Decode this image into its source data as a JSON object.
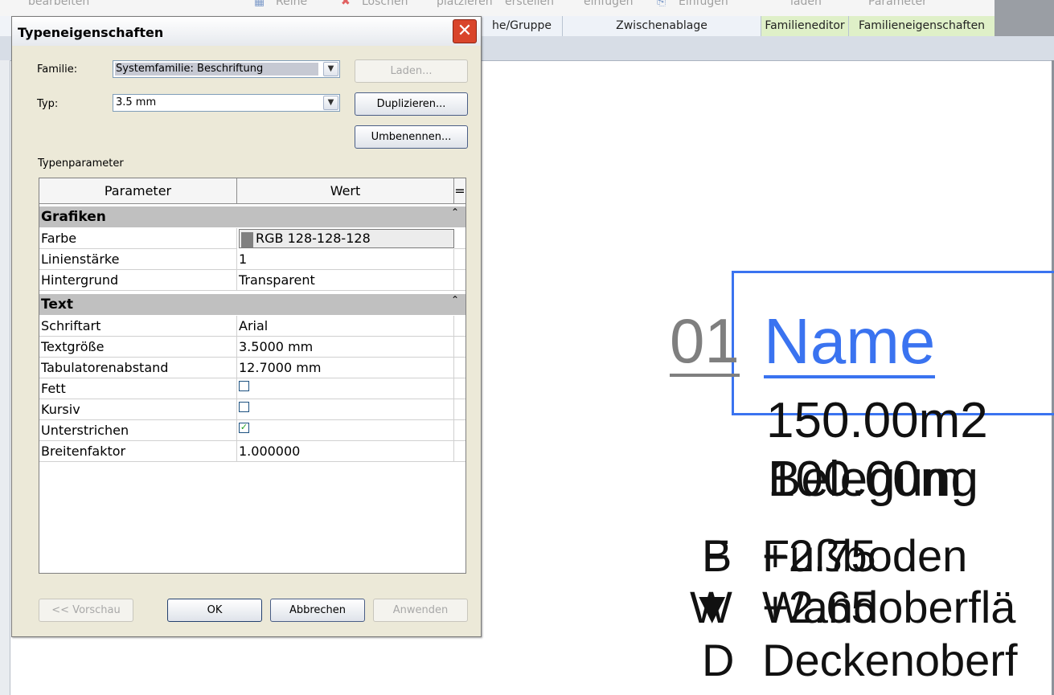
{
  "ribbon": {
    "top_labels": [
      "bearbeiten",
      "Reihe",
      "Löschen",
      "platzieren",
      "erstellen",
      "einfügen",
      "Einfügen",
      "laden",
      "Parameter"
    ],
    "panels": [
      {
        "label": "he/Gruppe"
      },
      {
        "label": "Zwischenablage"
      },
      {
        "label": "Familieneditor"
      },
      {
        "label": "Familieneigenschaften"
      }
    ]
  },
  "dialog": {
    "title": "Typeneigenschaften",
    "family_label": "Familie:",
    "family_value": "Systemfamilie: Beschriftung",
    "type_label": "Typ:",
    "type_value": "3.5 mm",
    "load_button": "Laden...",
    "duplicate_button": "Duplizieren...",
    "rename_button": "Umbenennen...",
    "type_params_label": "Typenparameter",
    "grid": {
      "col_parameter": "Parameter",
      "col_value": "Wert",
      "col_extra": "=",
      "groups": [
        {
          "name": "Grafiken",
          "rows": [
            {
              "param": "Farbe",
              "value": "RGB 128-128-128",
              "kind": "color",
              "color": "#808080"
            },
            {
              "param": "Linienstärke",
              "value": "1"
            },
            {
              "param": "Hintergrund",
              "value": "Transparent"
            }
          ]
        },
        {
          "name": "Text",
          "rows": [
            {
              "param": "Schriftart",
              "value": "Arial"
            },
            {
              "param": "Textgröße",
              "value": "3.5000 mm"
            },
            {
              "param": "Tabulatorenabstand",
              "value": "12.7000 mm"
            },
            {
              "param": "Fett",
              "checked": false
            },
            {
              "param": "Kursiv",
              "checked": false
            },
            {
              "param": "Unterstrichen",
              "checked": true
            },
            {
              "param": "Breitenfaktor",
              "value": "1.000000"
            }
          ]
        }
      ]
    },
    "preview_button": "<< Vorschau",
    "ok_button": "OK",
    "cancel_button": "Abbrechen",
    "apply_button": "Anwenden"
  },
  "canvas": {
    "tag_number": "01",
    "tag_name": "Name",
    "area": "150.00m2",
    "height_a": "100.00m",
    "height_b": "Belegung",
    "code_1a": "B",
    "code_1b": "F",
    "line_1a": "+2.75",
    "line_1b": "Fußboden",
    "code_2a": "W",
    "code_2b": "▼",
    "line_2a": "+2.65",
    "line_2b": "Wandoberflä",
    "code_3": "D",
    "line_3": "Deckenoberf",
    "accent_color": "#3a73f0",
    "number_color": "#7f7f7f"
  }
}
